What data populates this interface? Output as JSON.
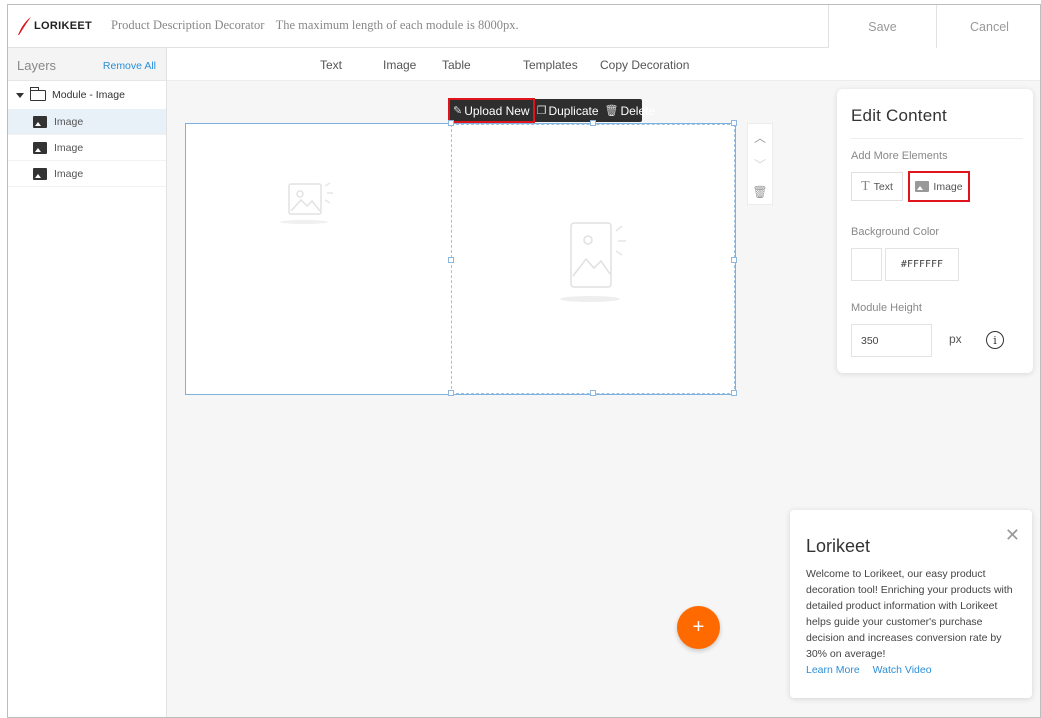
{
  "header": {
    "logo_text": "LORIKEET",
    "app_name": "Product Description Decorator",
    "hint": "The maximum length of each module is 8000px.",
    "save_label": "Save",
    "cancel_label": "Cancel"
  },
  "layers": {
    "title": "Layers",
    "remove_all_label": "Remove All",
    "module_label": "Module - Image",
    "items": [
      {
        "label": "Image",
        "selected": true
      },
      {
        "label": "Image",
        "selected": false
      },
      {
        "label": "Image",
        "selected": false
      }
    ]
  },
  "menu": {
    "items": [
      "Text",
      "Image",
      "Table",
      "Templates",
      "Copy Decoration"
    ]
  },
  "float_toolbar": {
    "upload_label": "Upload New",
    "duplicate_label": "Duplicate",
    "delete_label": "Delete"
  },
  "edit_panel": {
    "title": "Edit Content",
    "add_more_label": "Add More Elements",
    "text_button": "Text",
    "image_button": "Image",
    "bg_color_label": "Background Color",
    "bg_color_value": "#FFFFFF",
    "module_height_label": "Module Height",
    "module_height_value": "350",
    "unit": "px",
    "info_glyph": "i"
  },
  "welcome": {
    "title": "Lorikeet",
    "body": "Welcome to Lorikeet, our easy product decoration tool! Enriching your products with detailed product information with Lorikeet helps guide your customer's purchase decision and increases conversion rate by 30% on average!",
    "learn_more": "Learn More",
    "watch_video": "Watch Video"
  },
  "fab_label": "+",
  "colors": {
    "accent_orange": "#ff6a00",
    "link_blue": "#2b8fd8",
    "highlight_red": "#e0141b",
    "selection_blue": "#7fb1de",
    "logo_red": "#e0141b"
  }
}
